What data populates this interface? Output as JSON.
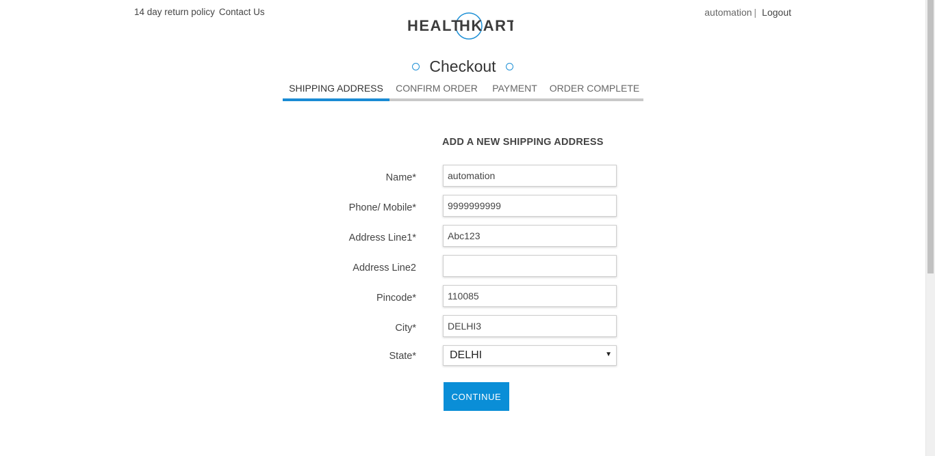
{
  "header": {
    "return_policy": "14 day return policy",
    "contact_us": "Contact Us",
    "username": "automation",
    "separator": "|",
    "logout": "Logout"
  },
  "logo": {
    "text_left": "HEALT",
    "text_right": "HKART",
    "accent_color": "#1e90d6"
  },
  "checkout": {
    "title": "Checkout",
    "steps": [
      {
        "label": "SHIPPING ADDRESS",
        "active": true
      },
      {
        "label": "CONFIRM ORDER",
        "active": false
      },
      {
        "label": "PAYMENT",
        "active": false
      },
      {
        "label": "ORDER COMPLETE",
        "active": false
      }
    ]
  },
  "form": {
    "heading": "ADD A NEW SHIPPING ADDRESS",
    "fields": {
      "name": {
        "label": "Name*",
        "value": "automation"
      },
      "phone": {
        "label": "Phone/ Mobile*",
        "value": "9999999999"
      },
      "address1": {
        "label": "Address Line1*",
        "value": "Abc123"
      },
      "address2": {
        "label": "Address Line2",
        "value": ""
      },
      "pincode": {
        "label": "Pincode*",
        "value": "110085"
      },
      "city": {
        "label": "City*",
        "value": "DELHI3"
      },
      "state": {
        "label": "State*",
        "value": "DELHI"
      }
    },
    "continue_label": "CONTINUE"
  },
  "colors": {
    "accent": "#0a8ed7",
    "step_underline": "#c9c9c9"
  }
}
